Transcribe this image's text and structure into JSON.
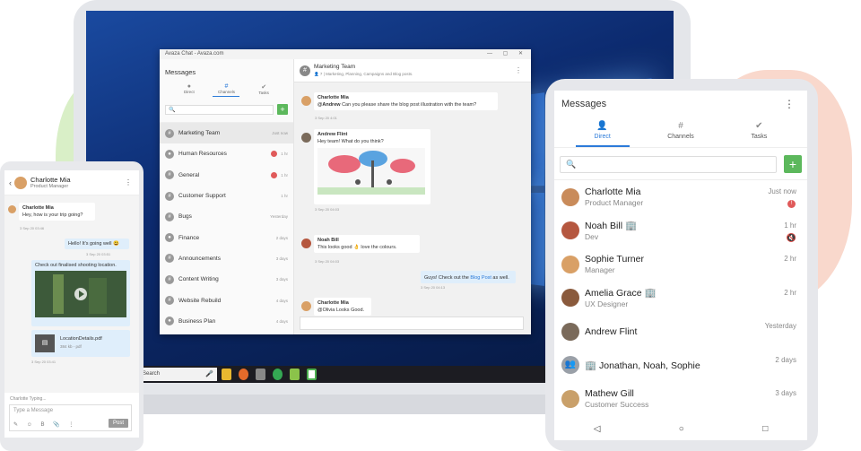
{
  "desktop": {
    "window_title": "Avaza Chat - Avaza.com",
    "window_controls": "— ▢ ✕",
    "sidebar_title": "Messages",
    "tabs": [
      {
        "label": "Direct",
        "icon": "person-icon"
      },
      {
        "label": "Channels",
        "icon": "hash-icon"
      },
      {
        "label": "Tasks",
        "icon": "check-circle-icon"
      }
    ],
    "search_icon": "🔍",
    "add_label": "+",
    "channels": [
      {
        "name": "Marketing Team",
        "icon": "#",
        "time": "Just now"
      },
      {
        "name": "Human Resources",
        "icon": "🔒",
        "time": "1 hr",
        "badge": true
      },
      {
        "name": "General",
        "icon": "#",
        "time": "1 hr",
        "badge": true
      },
      {
        "name": "Customer Support",
        "icon": "#",
        "time": "1 hr"
      },
      {
        "name": "Bugs",
        "icon": "#",
        "time": "Yesterday"
      },
      {
        "name": "Finance",
        "icon": "🔒",
        "time": "2 days"
      },
      {
        "name": "Announcements",
        "icon": "#",
        "time": "3 days"
      },
      {
        "name": "Content Writing",
        "icon": "#",
        "time": "3 days"
      },
      {
        "name": "Website Rebuild",
        "icon": "#",
        "time": "4 days"
      },
      {
        "name": "Business Plan",
        "icon": "🔒",
        "time": "4 days"
      }
    ],
    "channel_header": {
      "icon": "#",
      "title": "Marketing Team",
      "members": "7",
      "description": "Marketing, Planning, Campaigns and Blog posts.",
      "menu": "⋮"
    },
    "messages": [
      {
        "name": "Charlotte Mia",
        "mention": "@Andrew",
        "text": " Can you please share the blog  post illustration with the team?",
        "meta": "3 Sep 20 4:01"
      },
      {
        "name": "Andrew Flint",
        "text": "Hey team! What do you think?",
        "meta": "3 Sep 20 04:03"
      },
      {
        "name": "Noah Bill",
        "text": "This looks good 👌 love the colours.",
        "meta": "3 Sep 20 04:03"
      },
      {
        "text_pre": "Guys! Check out the ",
        "link": "Blog Post",
        "text_post": " as well.",
        "meta": "3 Sep 20 04:13"
      },
      {
        "name": "Charlotte Mia",
        "mention": "@Olivia",
        "text": " Looks Good.",
        "meta": "3 Sep 20 04:16"
      }
    ],
    "taskbar_search": "Search",
    "taskbar_mic": "🎤"
  },
  "left_phone": {
    "contact_name": "Charlotte Mia",
    "contact_role": "Product Manager",
    "back": "‹",
    "menu": "⋮",
    "messages": [
      {
        "name": "Charlotte Mia",
        "text": "Hey, how is your trip going?",
        "meta": "3 Sep 20 03:46"
      },
      {
        "text": "Hello! It's going well 😃",
        "meta": "3 Sep 20 03:51"
      },
      {
        "text": "Check out finalised shooting location.",
        "meta": ""
      },
      {
        "file_name": "LocationDetails.pdf",
        "file_meta": "384 kb - pdf",
        "meta": "3 Sep 20 03:41"
      }
    ],
    "typing": "Charlotte Typing...",
    "input_placeholder": "Type a Message",
    "tools": "✎ ☺ B 📎 ⋮",
    "post_label": "Post"
  },
  "right_phone": {
    "title": "Messages",
    "menu": "⋮",
    "tabs": [
      {
        "label": "Direct",
        "icon": "👤"
      },
      {
        "label": "Channels",
        "icon": "#"
      },
      {
        "label": "Tasks",
        "icon": "✔"
      }
    ],
    "search_icon": "🔍",
    "add_label": "+",
    "contacts": [
      {
        "name": "Charlotte Mia",
        "sub": "Product Manager",
        "time": "Just now",
        "badge": "!",
        "color": "#c98b5a"
      },
      {
        "name": "Noah Bill 🏢",
        "sub": "Dev",
        "time": "1 hr",
        "muted": true,
        "color": "#b5573f"
      },
      {
        "name": "Sophie Turner",
        "sub": "Manager",
        "time": "2 hr",
        "color": "#d9a066"
      },
      {
        "name": "Amelia Grace 🏢",
        "sub": "UX Designer",
        "time": "2 hr",
        "color": "#8a5a3c"
      },
      {
        "name": "Andrew Flint",
        "sub": "",
        "time": "Yesterday",
        "color": "#7a6a5a"
      },
      {
        "name": "🏢 Jonathan, Noah, Sophie",
        "sub": "",
        "time": "2 days",
        "color": "#9aa0a8"
      },
      {
        "name": "Mathew Gill",
        "sub": "Customer Success",
        "time": "3 days",
        "color": "#c9a06a"
      }
    ],
    "nav": [
      "◁",
      "○",
      "□"
    ]
  }
}
